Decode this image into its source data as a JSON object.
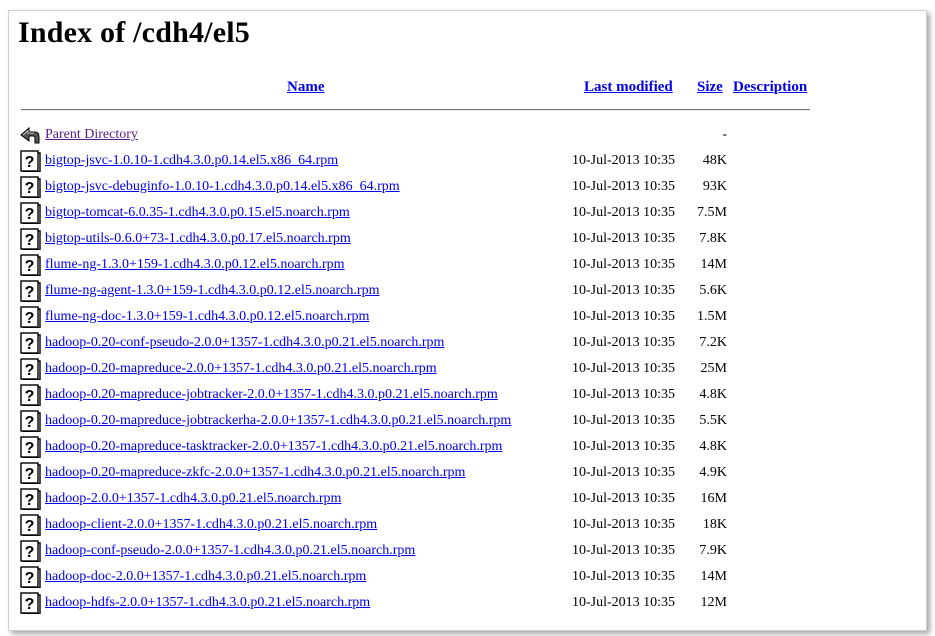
{
  "page": {
    "title": "Index of /cdh4/el5"
  },
  "columns": {
    "name": "Name",
    "last_modified": "Last modified",
    "size": "Size",
    "description": "Description"
  },
  "parent": {
    "label": "Parent Directory",
    "size": "-",
    "icon": "back-arrow-icon"
  },
  "files": [
    {
      "name": "bigtop-jsvc-1.0.10-1.cdh4.3.0.p0.14.el5.x86_64.rpm",
      "modified": "10-Jul-2013 10:35",
      "size": "48K",
      "icon": "unknown-file-icon"
    },
    {
      "name": "bigtop-jsvc-debuginfo-1.0.10-1.cdh4.3.0.p0.14.el5.x86_64.rpm",
      "modified": "10-Jul-2013 10:35",
      "size": "93K",
      "icon": "unknown-file-icon"
    },
    {
      "name": "bigtop-tomcat-6.0.35-1.cdh4.3.0.p0.15.el5.noarch.rpm",
      "modified": "10-Jul-2013 10:35",
      "size": "7.5M",
      "icon": "unknown-file-icon"
    },
    {
      "name": "bigtop-utils-0.6.0+73-1.cdh4.3.0.p0.17.el5.noarch.rpm",
      "modified": "10-Jul-2013 10:35",
      "size": "7.8K",
      "icon": "unknown-file-icon"
    },
    {
      "name": "flume-ng-1.3.0+159-1.cdh4.3.0.p0.12.el5.noarch.rpm",
      "modified": "10-Jul-2013 10:35",
      "size": "14M",
      "icon": "unknown-file-icon"
    },
    {
      "name": "flume-ng-agent-1.3.0+159-1.cdh4.3.0.p0.12.el5.noarch.rpm",
      "modified": "10-Jul-2013 10:35",
      "size": "5.6K",
      "icon": "unknown-file-icon"
    },
    {
      "name": "flume-ng-doc-1.3.0+159-1.cdh4.3.0.p0.12.el5.noarch.rpm",
      "modified": "10-Jul-2013 10:35",
      "size": "1.5M",
      "icon": "unknown-file-icon"
    },
    {
      "name": "hadoop-0.20-conf-pseudo-2.0.0+1357-1.cdh4.3.0.p0.21.el5.noarch.rpm",
      "modified": "10-Jul-2013 10:35",
      "size": "7.2K",
      "icon": "unknown-file-icon"
    },
    {
      "name": "hadoop-0.20-mapreduce-2.0.0+1357-1.cdh4.3.0.p0.21.el5.noarch.rpm",
      "modified": "10-Jul-2013 10:35",
      "size": "25M",
      "icon": "unknown-file-icon"
    },
    {
      "name": "hadoop-0.20-mapreduce-jobtracker-2.0.0+1357-1.cdh4.3.0.p0.21.el5.noarch.rpm",
      "modified": "10-Jul-2013 10:35",
      "size": "4.8K",
      "icon": "unknown-file-icon"
    },
    {
      "name": "hadoop-0.20-mapreduce-jobtrackerha-2.0.0+1357-1.cdh4.3.0.p0.21.el5.noarch.rpm",
      "modified": "10-Jul-2013 10:35",
      "size": "5.5K",
      "icon": "unknown-file-icon"
    },
    {
      "name": "hadoop-0.20-mapreduce-tasktracker-2.0.0+1357-1.cdh4.3.0.p0.21.el5.noarch.rpm",
      "modified": "10-Jul-2013 10:35",
      "size": "4.8K",
      "icon": "unknown-file-icon"
    },
    {
      "name": "hadoop-0.20-mapreduce-zkfc-2.0.0+1357-1.cdh4.3.0.p0.21.el5.noarch.rpm",
      "modified": "10-Jul-2013 10:35",
      "size": "4.9K",
      "icon": "unknown-file-icon"
    },
    {
      "name": "hadoop-2.0.0+1357-1.cdh4.3.0.p0.21.el5.noarch.rpm",
      "modified": "10-Jul-2013 10:35",
      "size": "16M",
      "icon": "unknown-file-icon"
    },
    {
      "name": "hadoop-client-2.0.0+1357-1.cdh4.3.0.p0.21.el5.noarch.rpm",
      "modified": "10-Jul-2013 10:35",
      "size": "18K",
      "icon": "unknown-file-icon"
    },
    {
      "name": "hadoop-conf-pseudo-2.0.0+1357-1.cdh4.3.0.p0.21.el5.noarch.rpm",
      "modified": "10-Jul-2013 10:35",
      "size": "7.9K",
      "icon": "unknown-file-icon"
    },
    {
      "name": "hadoop-doc-2.0.0+1357-1.cdh4.3.0.p0.21.el5.noarch.rpm",
      "modified": "10-Jul-2013 10:35",
      "size": "14M",
      "icon": "unknown-file-icon"
    },
    {
      "name": "hadoop-hdfs-2.0.0+1357-1.cdh4.3.0.p0.21.el5.noarch.rpm",
      "modified": "10-Jul-2013 10:35",
      "size": "12M",
      "icon": "unknown-file-icon"
    }
  ],
  "colors": {
    "link": "#0000ee",
    "visited": "#551a8b",
    "text": "#000000"
  }
}
